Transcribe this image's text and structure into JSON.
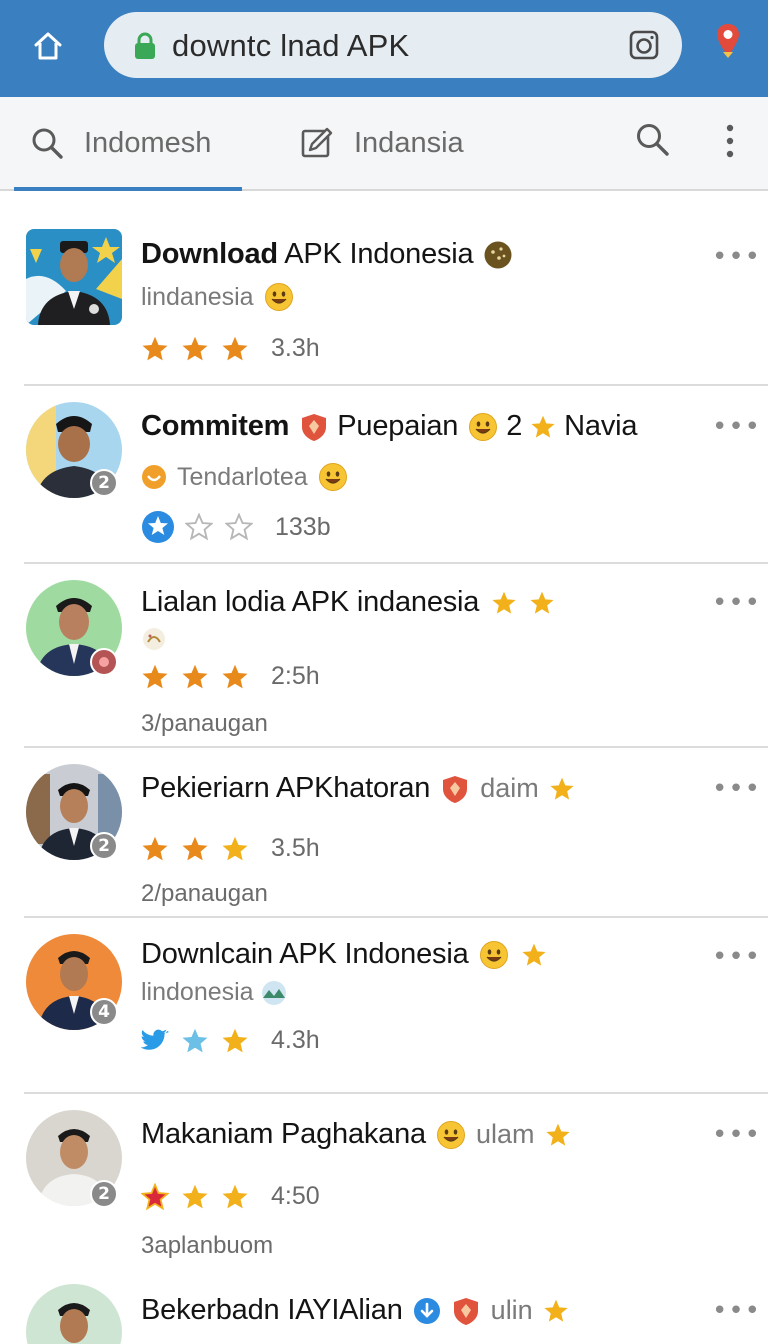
{
  "browser": {
    "url": "downtc lnad APK"
  },
  "tabs": [
    {
      "label": "Indomesh"
    },
    {
      "label": "Indansia"
    }
  ],
  "results": [
    {
      "title_bold": "Download",
      "title_rest": " APK Indonesia",
      "subtitle": "lindanesia",
      "rating_text": "3.3h",
      "meta": "",
      "badge": ""
    },
    {
      "title_bold": "Commitem",
      "title_rest": "",
      "title_tail": "Puepaian",
      "title_num": "2",
      "title_tail2": "Navia",
      "subtitle": "Tendarlotea",
      "rating_text": "133b",
      "meta": "",
      "badge": "2"
    },
    {
      "title_bold": "",
      "title_rest": "Lialan lodia APK indanesia",
      "subtitle": "",
      "rating_text": "2:5h",
      "meta": "3/panaugan",
      "badge": ""
    },
    {
      "title_bold": "",
      "title_rest": "Pekieriarn APKhatoran",
      "title_gray": "daim",
      "subtitle": "",
      "rating_text": "3.5h",
      "meta": "2/panaugan",
      "badge": "2"
    },
    {
      "title_bold": "",
      "title_rest": "Downlcain APK Indonesia",
      "subtitle": "lindonesia",
      "rating_text": "4.3h",
      "meta": "",
      "badge": "4"
    },
    {
      "title_bold": "",
      "title_rest": "Makaniam Paghakana",
      "title_gray": "ulam",
      "subtitle": "",
      "rating_text": "4:50",
      "meta": "3aplanbuom",
      "badge": "2"
    },
    {
      "title_bold": "",
      "title_rest": "Bekerbadn IAYIAlian",
      "title_gray": "ulin",
      "subtitle": "",
      "rating_text": "",
      "meta": "",
      "badge": ""
    }
  ],
  "more_label": "•••",
  "colors": {
    "topbar": "#3a7fbf",
    "accent": "#3a7fbf",
    "star_orange": "#e8891c",
    "star_yellow": "#f2b11a"
  }
}
